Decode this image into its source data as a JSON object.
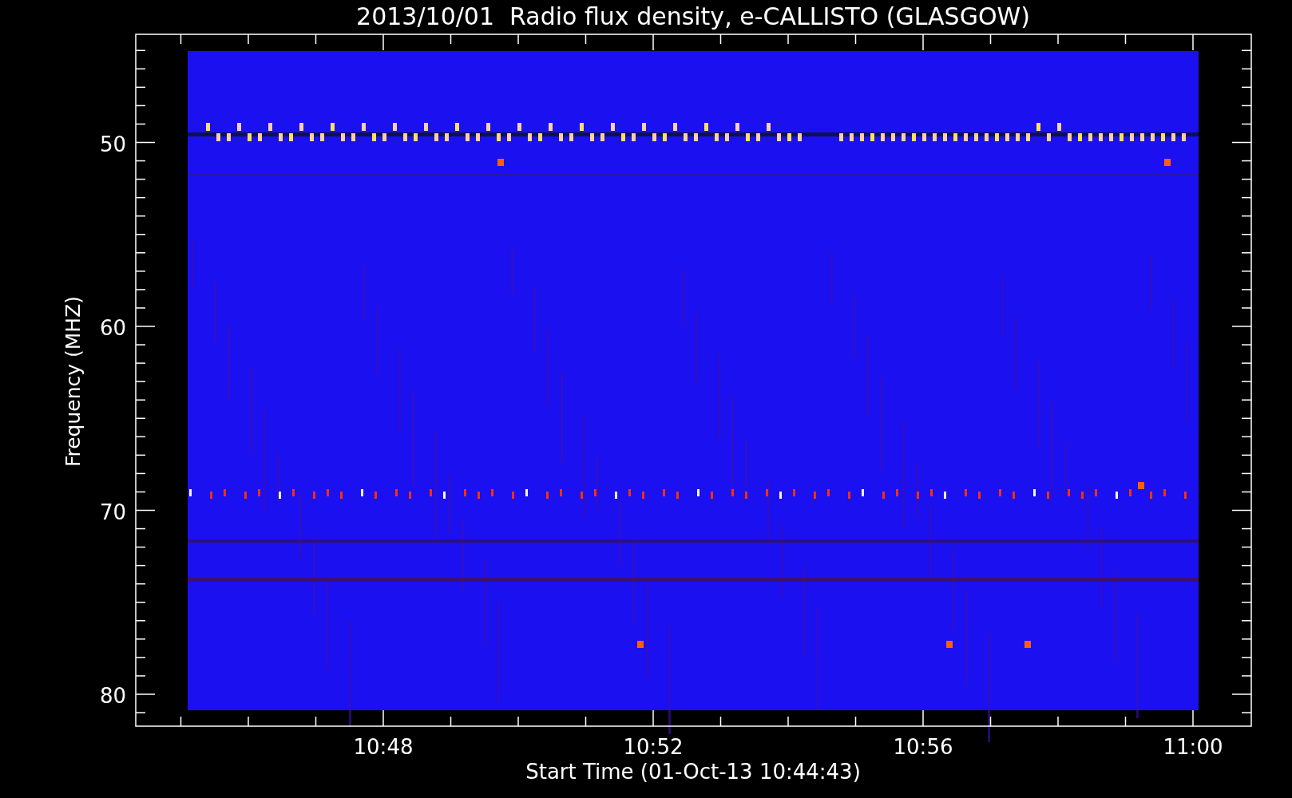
{
  "title": "2013/10/01  Radio flux density, e-CALLISTO (GLASGOW)",
  "plot": {
    "ylabel": "Frequency (MHZ)",
    "xlabel": "Start Time (01-Oct-13 10:44:43)",
    "yticks": [
      "50",
      "60",
      "70",
      "80"
    ],
    "xticks": [
      "10:48",
      "10:52",
      "10:56",
      "11:00"
    ]
  }
}
